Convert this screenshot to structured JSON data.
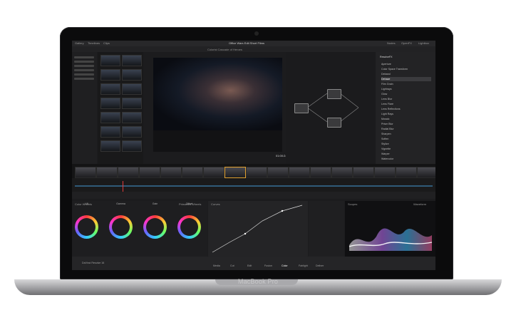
{
  "device": {
    "brand_label": "MacBook Pro"
  },
  "app": {
    "title": "Office Wars Edit Short Films",
    "subtitle": "Colorist Cascade of Heroes",
    "timecode": "01:00:24:06",
    "app_name": "DaVinci Resolve 16"
  },
  "menu": {
    "left": [
      "Gallery",
      "Timelines",
      "Clips"
    ],
    "right": [
      "Nodes",
      "OpenFX",
      "Lightbox"
    ]
  },
  "effects_panel": {
    "header": "ResolveFX",
    "items": [
      "Aperture",
      "Color Space Transform",
      "Deband",
      "Dehaze",
      "Film Grain",
      "Lightrays",
      "Glow",
      "Lens Blur",
      "Lens Flare",
      "Lens Reflections",
      "Light Rays",
      "Mosaic",
      "Prism Blur",
      "Radial Blur",
      "Sharpen",
      "Soften",
      "Stylize",
      "Vignette",
      "Warper",
      "Watercolor"
    ],
    "selected_index": 3
  },
  "color": {
    "panel_title": "Color Wheels",
    "primaries_label": "Primaries Wheels",
    "wheels": [
      "Lift",
      "Gamma",
      "Gain",
      "Offset"
    ],
    "curves_title": "Curves",
    "scope_title": "Scopes",
    "scope_mode": "Waveform"
  },
  "pages": [
    "Media",
    "Cut",
    "Edit",
    "Fusion",
    "Color",
    "Fairlight",
    "Deliver"
  ],
  "colors": {
    "accent": "#e0a030",
    "playhead": "#e23b3b"
  }
}
